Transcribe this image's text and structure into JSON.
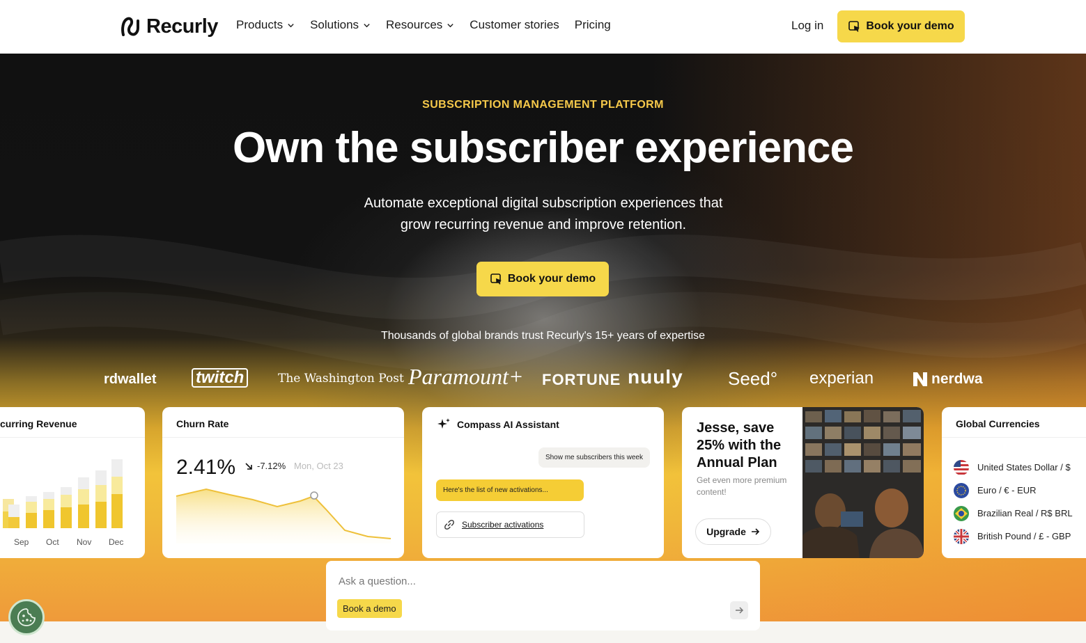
{
  "nav": {
    "brand": "Recurly",
    "items": [
      {
        "label": "Products",
        "dropdown": true
      },
      {
        "label": "Solutions",
        "dropdown": true
      },
      {
        "label": "Resources",
        "dropdown": true
      },
      {
        "label": "Customer stories",
        "dropdown": false
      },
      {
        "label": "Pricing",
        "dropdown": false
      }
    ],
    "login": "Log in",
    "cta": "Book your demo"
  },
  "hero": {
    "eyebrow": "SUBSCRIPTION MANAGEMENT PLATFORM",
    "headline": "Own the subscriber experience",
    "subline_1": "Automate exceptional digital subscription experiences that",
    "subline_2": "grow recurring revenue and improve retention.",
    "cta": "Book your demo",
    "trust": "Thousands of global brands trust Recurly's 15+ years of expertise"
  },
  "brands": [
    "rdwallet",
    "twitch",
    "The Washington Post",
    "Paramount+",
    "FORTUNE",
    "nuuly",
    "Seed°",
    "experian",
    "nerdwa"
  ],
  "cards": {
    "revenue": {
      "title": "curring Revenue",
      "months": [
        "Sep",
        "Oct",
        "Nov",
        "Dec"
      ]
    },
    "churn": {
      "title": "Churn Rate",
      "rate": "2.41%",
      "delta": "-7.12%",
      "date": "Mon, Oct 23"
    },
    "ai": {
      "title": "Compass AI Assistant",
      "question": "Show me subscribers this week",
      "answer": "Here's the list of new activations...",
      "link": "Subscriber activations"
    },
    "promo": {
      "title": "Jesse, save 25% with the Annual Plan",
      "subtitle": "Get even more premium content!",
      "button": "Upgrade"
    },
    "currencies": {
      "title": "Global Currencies",
      "items": [
        "United States Dollar / $",
        "Euro / € - EUR",
        "Brazilian Real / R$ BRL",
        "British Pound / £ - GBP"
      ]
    }
  },
  "ask": {
    "placeholder": "Ask a question...",
    "chip": "Book a demo"
  },
  "colors": {
    "accent": "#f6d84a",
    "eyebrow": "#f6c94a",
    "dark": "#111111"
  }
}
